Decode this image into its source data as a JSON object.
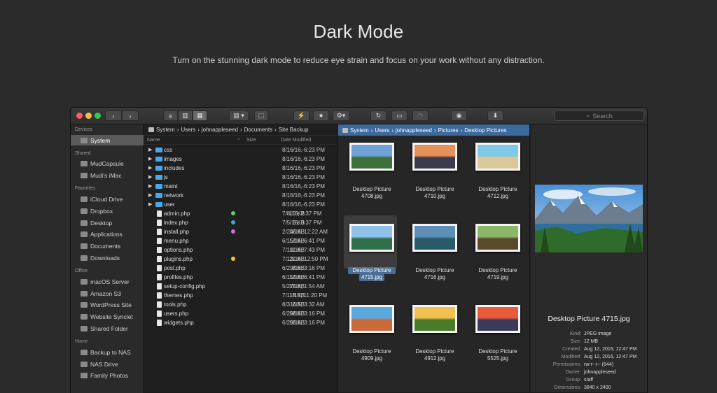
{
  "hero": {
    "title": "Dark Mode",
    "subtitle": "Turn on the stunning dark mode to reduce eye strain and focus on your work without any distraction."
  },
  "toolbar": {
    "search_placeholder": "Search"
  },
  "sidebar": {
    "sections": [
      {
        "title": "Devices",
        "items": [
          {
            "label": "System",
            "icon": "hard-drive-icon",
            "selected": true
          }
        ]
      },
      {
        "title": "Shared",
        "items": [
          {
            "label": "MudCapsule",
            "icon": "monitor-icon"
          },
          {
            "label": "Mudi's iMac",
            "icon": "imac-icon"
          }
        ]
      },
      {
        "title": "Favorites",
        "items": [
          {
            "label": "iCloud Drive",
            "icon": "cloud-icon"
          },
          {
            "label": "Dropbox",
            "icon": "dropbox-icon"
          },
          {
            "label": "Desktop",
            "icon": "folder-icon"
          },
          {
            "label": "Applications",
            "icon": "applications-icon"
          },
          {
            "label": "Documents",
            "icon": "folder-icon"
          },
          {
            "label": "Downloads",
            "icon": "download-icon"
          }
        ]
      },
      {
        "title": "Office",
        "items": [
          {
            "label": "macOS Server",
            "icon": "server-icon"
          },
          {
            "label": "Amazon S3",
            "icon": "amazon-s3-icon"
          },
          {
            "label": "WordPress Site",
            "icon": "wordpress-icon"
          },
          {
            "label": "Website Synclet",
            "icon": "sync-icon"
          },
          {
            "label": "Shared Folder",
            "icon": "shared-folder-icon"
          }
        ]
      },
      {
        "title": "Home",
        "items": [
          {
            "label": "Backup to NAS",
            "icon": "sync-icon"
          },
          {
            "label": "NAS Drive",
            "icon": "nas-icon"
          },
          {
            "label": "Family Photos",
            "icon": "folder-icon"
          }
        ]
      }
    ]
  },
  "list_pane": {
    "path": [
      "System",
      "Users",
      "johnappleseed",
      "Documents",
      "Site Backup"
    ],
    "columns": {
      "name": "Name",
      "size": "Size",
      "date": "Date Modified"
    },
    "rows": [
      {
        "name": "css",
        "folder": true,
        "size": "--",
        "date": "8/16/16, 6:23 PM"
      },
      {
        "name": "images",
        "folder": true,
        "size": "--",
        "date": "8/16/16, 6:23 PM"
      },
      {
        "name": "includes",
        "folder": true,
        "size": "--",
        "date": "8/16/16, 6:23 PM"
      },
      {
        "name": "js",
        "folder": true,
        "size": "--",
        "date": "8/16/16, 6:23 PM"
      },
      {
        "name": "maint",
        "folder": true,
        "size": "--",
        "date": "8/16/16, 6:23 PM"
      },
      {
        "name": "network",
        "folder": true,
        "size": "--",
        "date": "8/16/16, 6:23 PM"
      },
      {
        "name": "user",
        "folder": true,
        "size": "--",
        "date": "8/16/16, 6:23 PM"
      },
      {
        "name": "admin.php",
        "folder": false,
        "tag": "#4cd964",
        "size": "10 KB",
        "date": "7/8/16, 2:37 PM"
      },
      {
        "name": "index.php",
        "folder": false,
        "tag": "#35aadc",
        "size": "6 KB",
        "date": "7/5/16, 3:37 PM"
      },
      {
        "name": "install.php",
        "folder": false,
        "tag": "#d070d0",
        "size": "16 KB",
        "date": "2/24/16, 12:22 AM"
      },
      {
        "name": "menu.php",
        "folder": false,
        "size": "13 KB",
        "date": "6/15/16, 6:41 PM"
      },
      {
        "name": "options.php",
        "folder": false,
        "size": "11 KB",
        "date": "7/10/16, 7:43 PM"
      },
      {
        "name": "plugins.php",
        "folder": false,
        "tag": "#f5c242",
        "size": "21 KB",
        "date": "7/13/16, 12:50 PM"
      },
      {
        "name": "post.php",
        "folder": false,
        "size": "8 KB",
        "date": "6/29/16, 3:16 PM"
      },
      {
        "name": "profiles.php",
        "folder": false,
        "size": "13 KB",
        "date": "6/15/16, 6:41 PM"
      },
      {
        "name": "setup-config.php",
        "folder": false,
        "size": "15 KB",
        "date": "5/27/16, 1:54 AM"
      },
      {
        "name": "themes.php",
        "folder": false,
        "size": "18 KB",
        "date": "7/11/16, 11:20 PM"
      },
      {
        "name": "tools.php",
        "folder": false,
        "size": "6 KB",
        "date": "8/31/15, 3:32 AM"
      },
      {
        "name": "users.php",
        "folder": false,
        "size": "18 KB",
        "date": "6/29/16, 3:16 PM"
      },
      {
        "name": "widgets.php",
        "folder": false,
        "size": "16 KB",
        "date": "6/29/16, 3:16 PM"
      }
    ]
  },
  "icon_pane": {
    "path": [
      "System",
      "Users",
      "johnappleseed",
      "Pictures",
      "Desktop Pictures"
    ],
    "items": [
      {
        "name": "Desktop Picture 4708.jpg",
        "l1": "Desktop Picture",
        "l2": "4708.jpg",
        "colors": [
          "#6fa3d8",
          "#3f6f3a"
        ]
      },
      {
        "name": "Desktop Picture 4710.jpg",
        "l1": "Desktop Picture",
        "l2": "4710.jpg",
        "colors": [
          "#e8905a",
          "#3a3a4a"
        ]
      },
      {
        "name": "Desktop Picture 4712.jpg",
        "l1": "Desktop Picture",
        "l2": "4712.jpg",
        "colors": [
          "#7ec8e8",
          "#d8c89a"
        ]
      },
      {
        "name": "Desktop Picture 4715.jpg",
        "l1": "Desktop Picture",
        "l2": "4715.jpg",
        "colors": [
          "#8ec0e8",
          "#2f6f4a"
        ],
        "selected": true
      },
      {
        "name": "Desktop Picture 4716.jpg",
        "l1": "Desktop Picture",
        "l2": "4716.jpg",
        "colors": [
          "#5f8fb8",
          "#2a5a6a"
        ]
      },
      {
        "name": "Desktop Picture 4719.jpg",
        "l1": "Desktop Picture",
        "l2": "4719.jpg",
        "colors": [
          "#8ab868",
          "#5a4a2a"
        ]
      },
      {
        "name": "Desktop Picture 4909.jpg",
        "l1": "Desktop Picture",
        "l2": "4909.jpg",
        "colors": [
          "#5aa8e0",
          "#c86a3a"
        ]
      },
      {
        "name": "Desktop Picture 4912.jpg",
        "l1": "Desktop Picture",
        "l2": "4912.jpg",
        "colors": [
          "#f0c050",
          "#4a7a2a"
        ]
      },
      {
        "name": "Desktop Picture 5525.jpg",
        "l1": "Desktop Picture",
        "l2": "5525.jpg",
        "colors": [
          "#e85a3a",
          "#3a3a5a"
        ]
      }
    ]
  },
  "info_pane": {
    "title": "Desktop Picture 4715.jpg",
    "fields": [
      {
        "k": "Kind:",
        "v": "JPEG image"
      },
      {
        "k": "Size:",
        "v": "12 MB"
      },
      {
        "k": "Created:",
        "v": "Aug 12, 2016, 12:47 PM"
      },
      {
        "k": "Modified:",
        "v": "Aug 12, 2016, 12:47 PM"
      },
      {
        "k": "Permissions:",
        "v": "rw-r--r-- (644)"
      },
      {
        "k": "Owner:",
        "v": "johnappleseed"
      },
      {
        "k": "Group:",
        "v": "staff"
      },
      {
        "k": "Dimensions:",
        "v": "3840 x 2400"
      }
    ]
  }
}
